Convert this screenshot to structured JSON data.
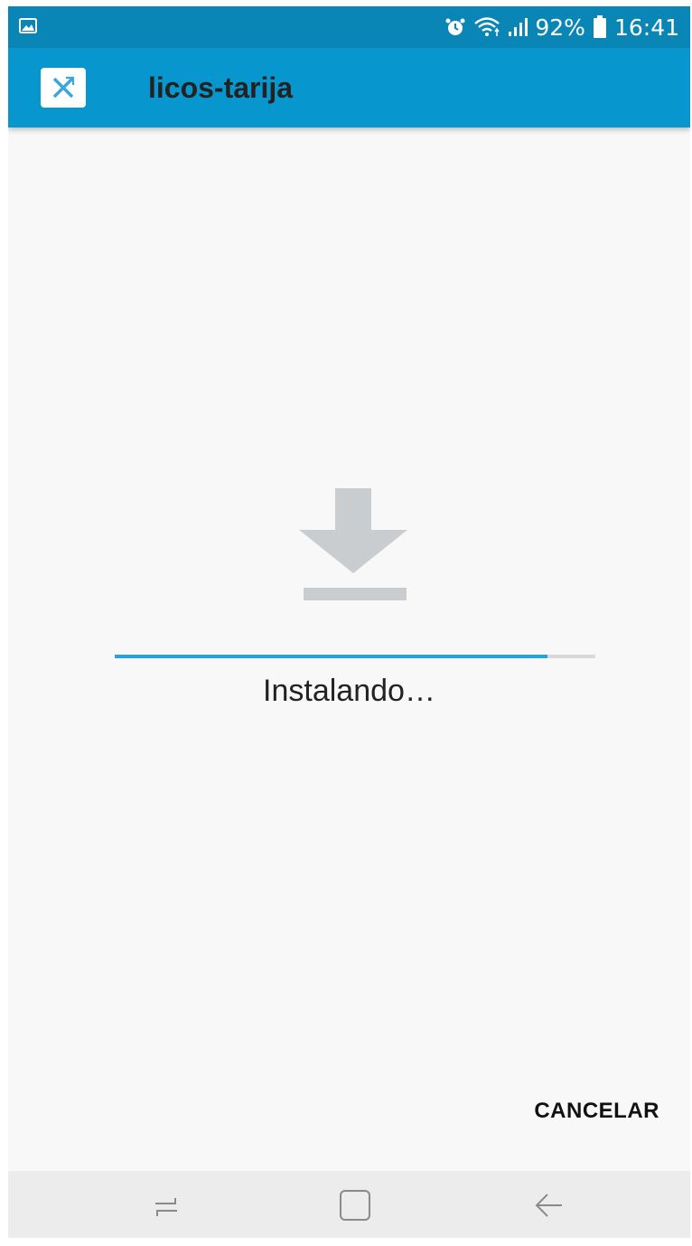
{
  "status_bar": {
    "battery": "92%",
    "time": "16:41",
    "icons": [
      "image-notification-icon",
      "alarm-icon",
      "wifi-icon",
      "signal-icon",
      "battery-icon"
    ]
  },
  "app_bar": {
    "title": "licos-tarija",
    "icon": "app-logo-icon",
    "color": "#0796ce"
  },
  "install": {
    "icon": "download-icon",
    "progress": 0.9,
    "status_text": "Instalando…",
    "accent": "#27a3d9"
  },
  "actions": {
    "cancel_label": "CANCELAR"
  },
  "nav_bar": {
    "icons": [
      "recent-apps-icon",
      "home-icon",
      "back-icon"
    ]
  }
}
